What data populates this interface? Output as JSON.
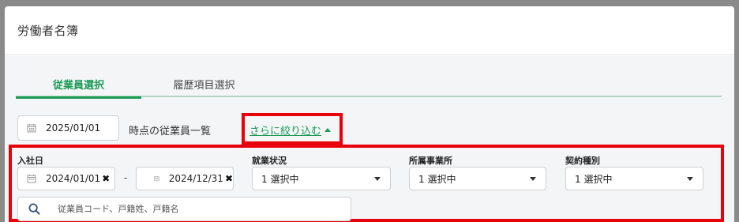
{
  "modal": {
    "title": "労働者名簿"
  },
  "tabs": [
    {
      "label": "従業員選択",
      "active": true
    },
    {
      "label": "履歴項目選択",
      "active": false
    }
  ],
  "as_of": {
    "date": "2025/01/01",
    "suffix": "時点の従業員一覧"
  },
  "filter_toggle": {
    "label": "さらに絞り込む",
    "icon": "caret-up-icon"
  },
  "filters": {
    "hire_date": {
      "label": "入社日",
      "from": "2024/01/01",
      "to": "2024/12/31",
      "separator": "-"
    },
    "employment_status": {
      "label": "就業状況",
      "value": "1 選択中"
    },
    "office": {
      "label": "所属事業所",
      "value": "1 選択中"
    },
    "contract_type": {
      "label": "契約種別",
      "value": "1 選択中"
    }
  },
  "search": {
    "placeholder": "従業員コード、戸籍姓、戸籍名",
    "icon": "search-icon"
  },
  "colors": {
    "accent": "#1a9a54",
    "highlight": "#e8000b",
    "panel_bg": "#f4f5f7"
  }
}
